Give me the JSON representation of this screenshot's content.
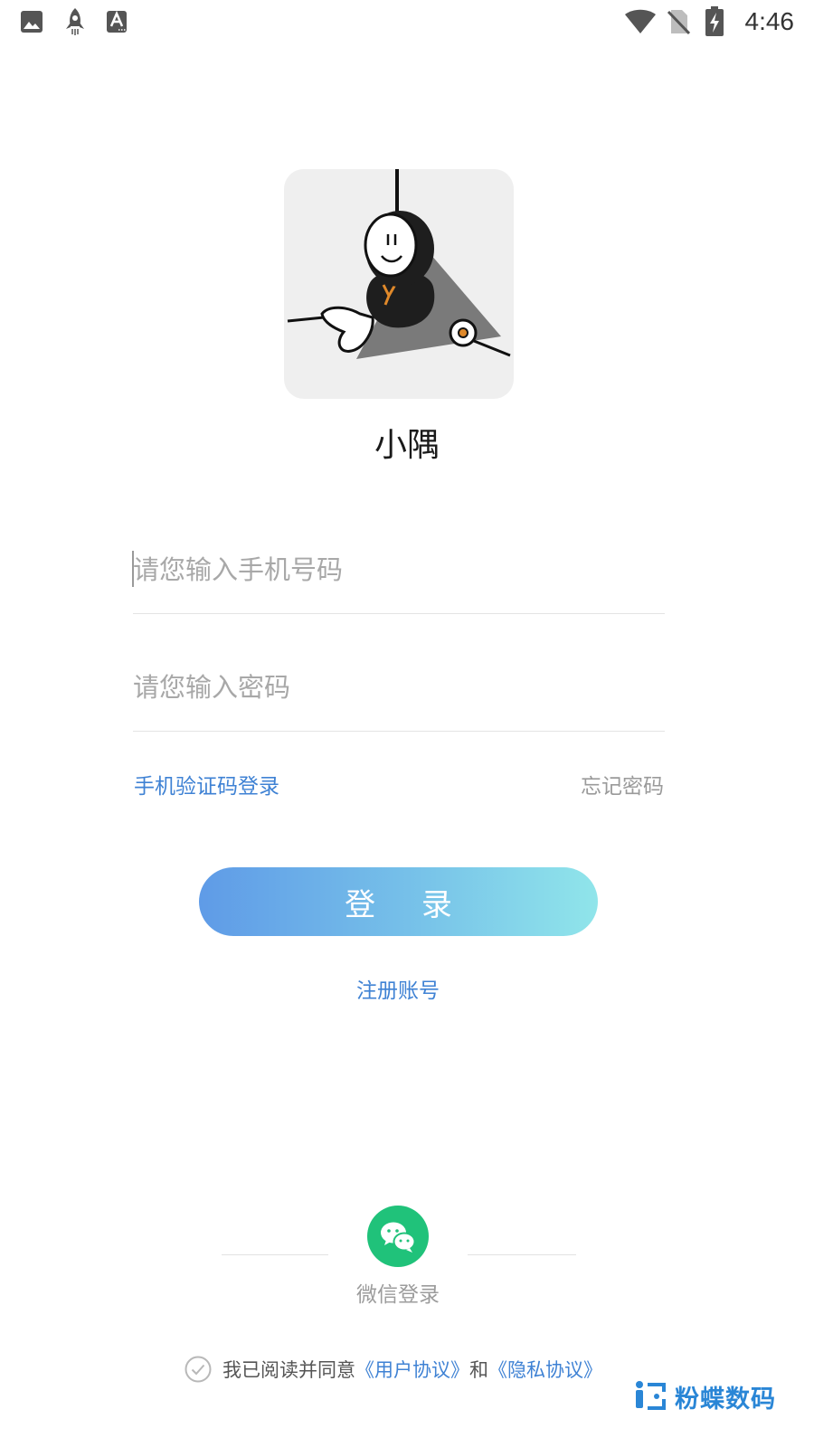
{
  "status_bar": {
    "time": "4:46",
    "left_icons": [
      "image-icon",
      "rocket-icon",
      "text-a-icon"
    ],
    "right_icons": [
      "wifi-icon",
      "no-sim-icon",
      "battery-charging-icon"
    ]
  },
  "app": {
    "name": "小隅",
    "logo_icon": "hanging-character-logo"
  },
  "form": {
    "phone_placeholder": "请您输入手机号码",
    "phone_value": "",
    "password_placeholder": "请您输入密码",
    "password_value": "",
    "sms_login_label": "手机验证码登录",
    "forgot_password_label": "忘记密码",
    "login_button_label": "登 录",
    "register_label": "注册账号"
  },
  "social": {
    "wechat_icon": "wechat-icon",
    "wechat_label": "微信登录"
  },
  "agreement": {
    "checked": false,
    "prefix": "我已阅读并同意",
    "user_agreement": "《用户协议》",
    "conjunction": "和",
    "privacy_policy": "《隐私协议》"
  },
  "watermark": {
    "text": "粉蝶数码"
  },
  "colors": {
    "link": "#3f82d4",
    "wechat": "#20c27a",
    "button_gradient_start": "#5f9be7",
    "button_gradient_end": "#90e5ea"
  }
}
